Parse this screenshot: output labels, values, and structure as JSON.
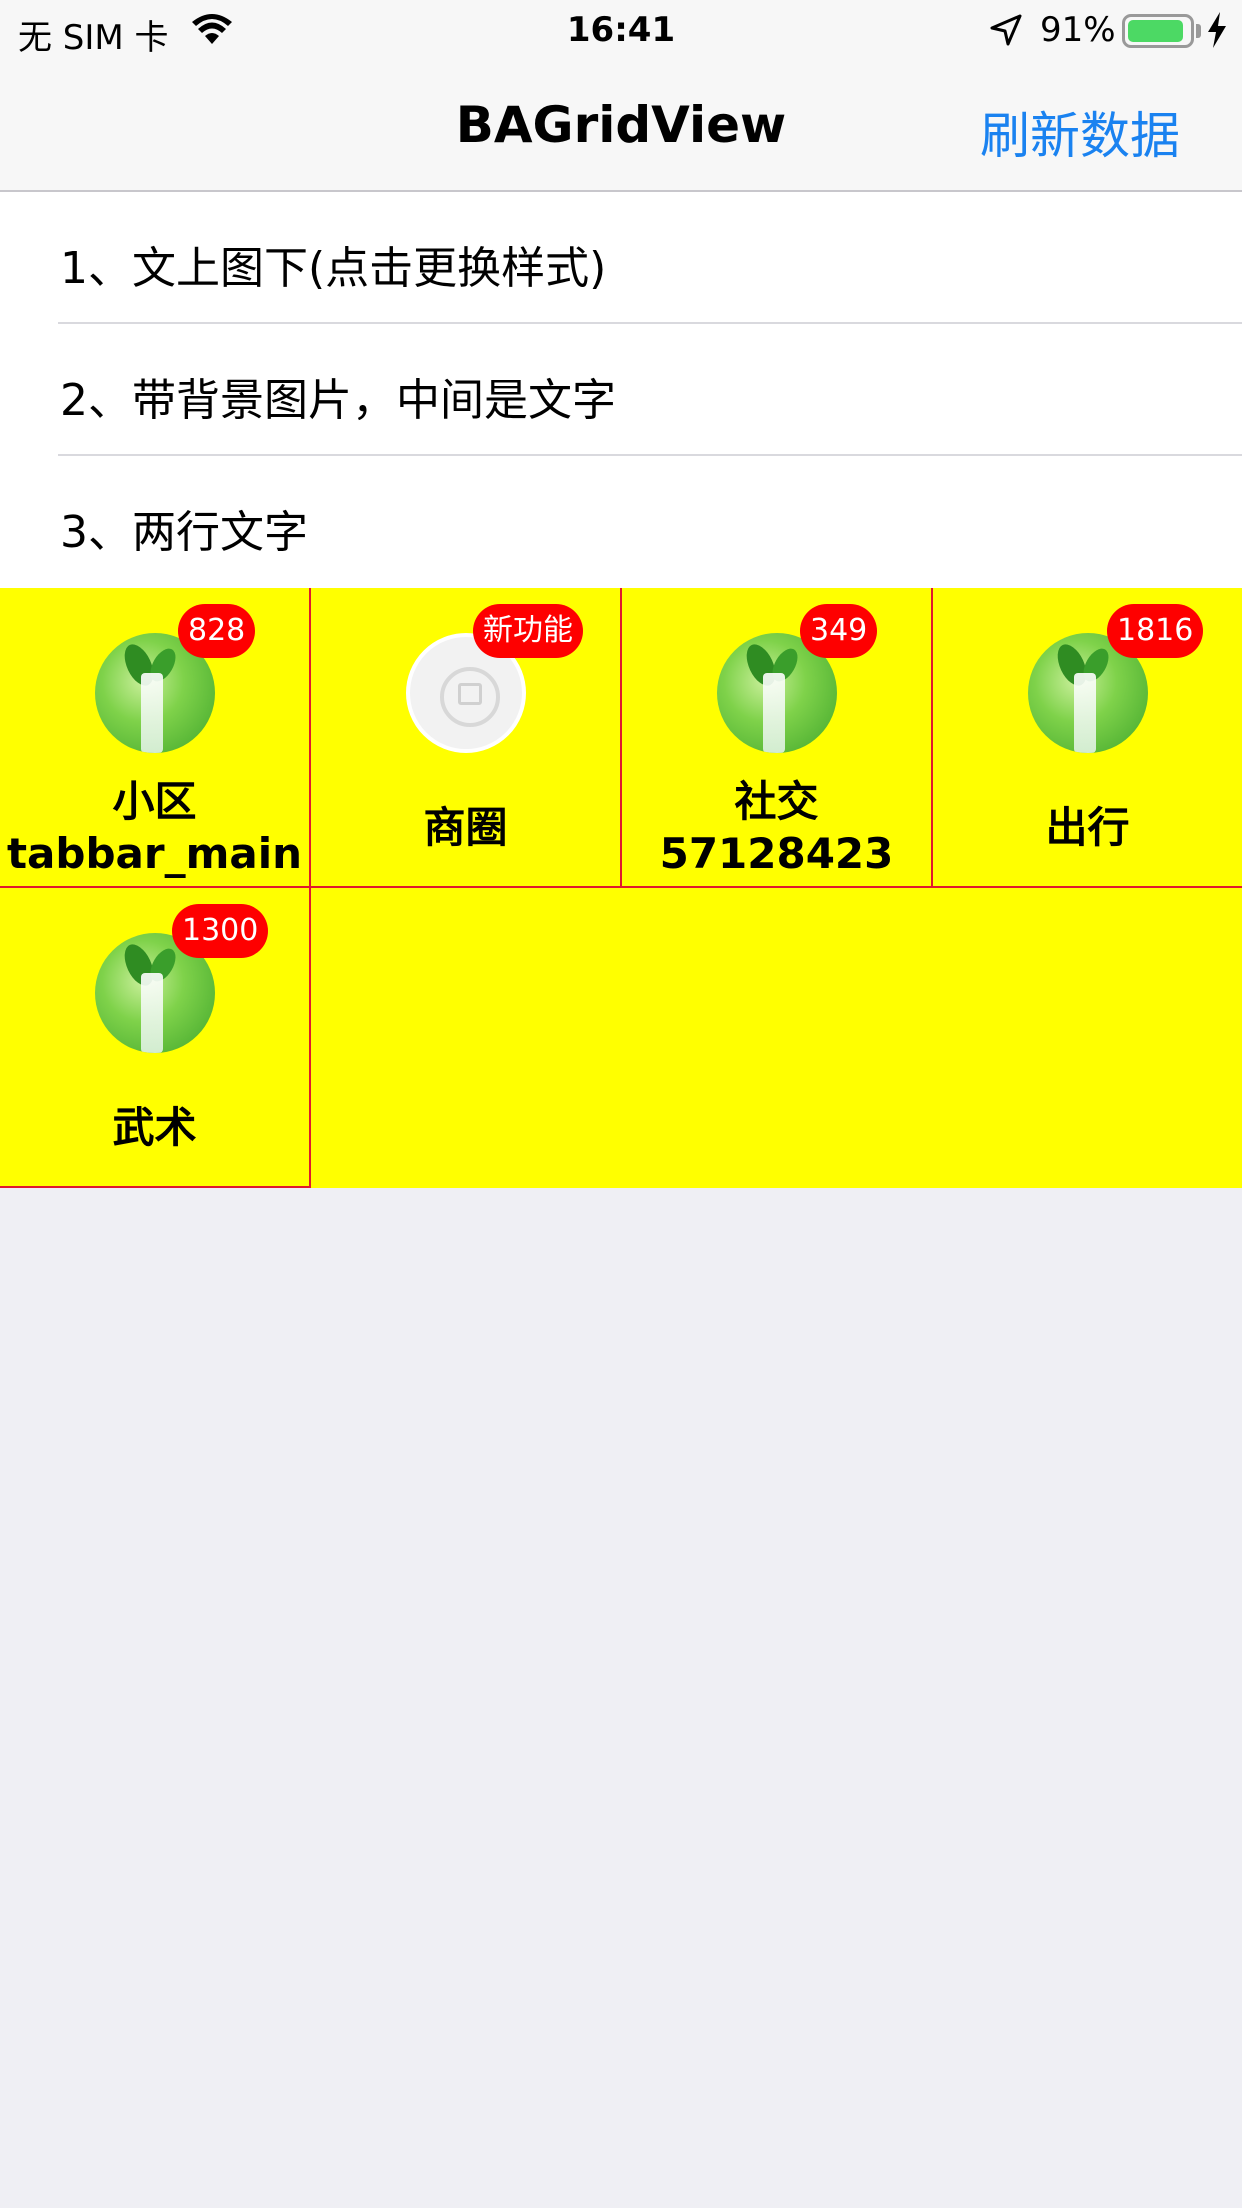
{
  "status_bar": {
    "carrier": "无 SIM 卡",
    "time": "16:41",
    "battery_percent": "91%",
    "battery_level": 0.91,
    "icons": [
      "wifi-icon",
      "location-icon",
      "battery-icon",
      "charging-icon"
    ]
  },
  "nav": {
    "title": "BAGridView",
    "right_button": "刷新数据"
  },
  "list": {
    "items": [
      {
        "label": "1、文上图下(点击更换样式)"
      },
      {
        "label": "2、带背景图片，中间是文字"
      },
      {
        "label": "3、两行文字"
      }
    ]
  },
  "grid": {
    "items": [
      {
        "title_line1": "小区",
        "title_line2": "tabbar_main",
        "badge": "828",
        "icon": "plant-photo-icon"
      },
      {
        "title_line1": "商圈",
        "title_line2": "",
        "badge": "新功能",
        "icon": "image-placeholder-icon"
      },
      {
        "title_line1": "社交",
        "title_line2": "57128423",
        "badge": "349",
        "icon": "plant-photo-icon"
      },
      {
        "title_line1": "出行",
        "title_line2": "",
        "badge": "1816",
        "icon": "plant-photo-icon"
      },
      {
        "title_line1": "武术",
        "title_line2": "",
        "badge": "1300",
        "icon": "plant-photo-icon"
      }
    ]
  },
  "colors": {
    "grid_background": "#ffff00",
    "cell_border": "#e0192e",
    "badge": "#fe0000",
    "nav_button": "#1a82f0",
    "page_background": "#efeff4"
  }
}
